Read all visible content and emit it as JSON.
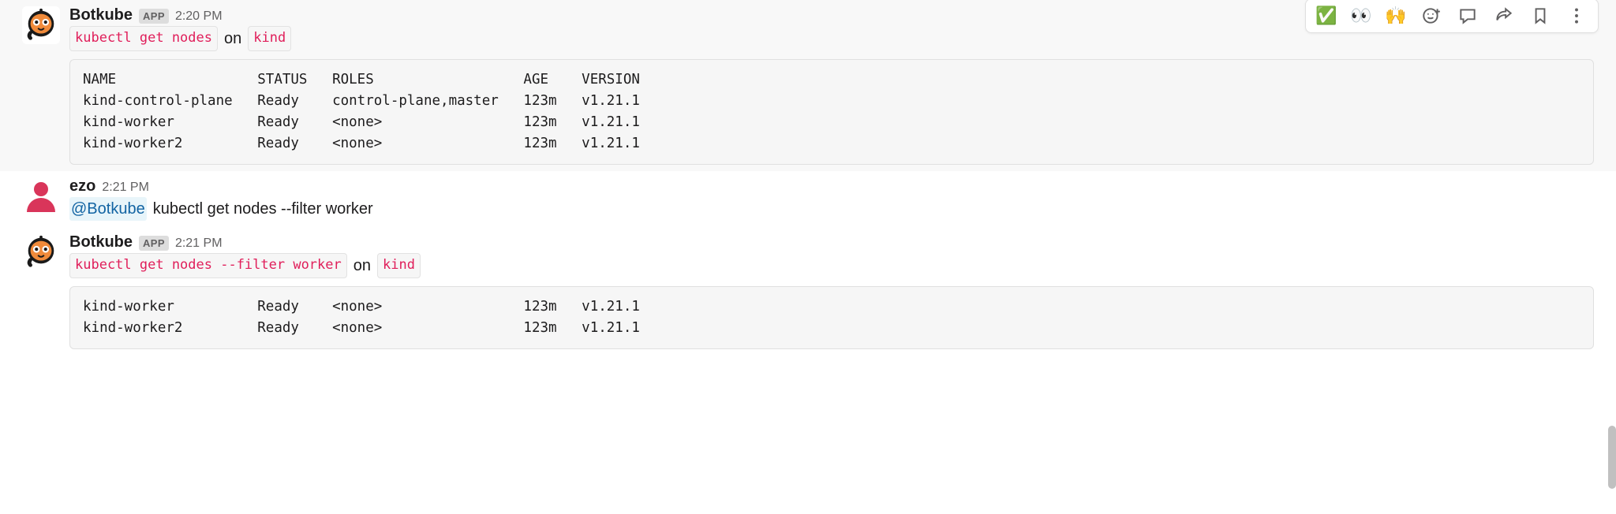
{
  "messages": [
    {
      "sender": "Botkube",
      "is_app": true,
      "app_badge": "APP",
      "timestamp": "2:20 PM",
      "avatar_kind": "bot",
      "command_pill": "kubectl get nodes",
      "on_word": "on",
      "cluster_pill": "kind",
      "code_block_lines": [
        "NAME                 STATUS   ROLES                  AGE    VERSION",
        "kind-control-plane   Ready    control-plane,master   123m   v1.21.1",
        "kind-worker          Ready    <none>                 123m   v1.21.1",
        "kind-worker2         Ready    <none>                 123m   v1.21.1"
      ],
      "hovered": true
    },
    {
      "sender": "ezo",
      "is_app": false,
      "timestamp": "2:21 PM",
      "avatar_kind": "human",
      "mention": "@Botkube",
      "plain_text": " kubectl get nodes --filter worker"
    },
    {
      "sender": "Botkube",
      "is_app": true,
      "app_badge": "APP",
      "timestamp": "2:21 PM",
      "avatar_kind": "bot",
      "command_pill": "kubectl get nodes --filter worker",
      "on_word": "on",
      "cluster_pill": "kind",
      "code_block_lines": [
        "kind-worker          Ready    <none>                 123m   v1.21.1",
        "kind-worker2         Ready    <none>                 123m   v1.21.1"
      ]
    }
  ],
  "actions": {
    "check": "✅",
    "eyes": "👀",
    "hands": "🙌"
  }
}
